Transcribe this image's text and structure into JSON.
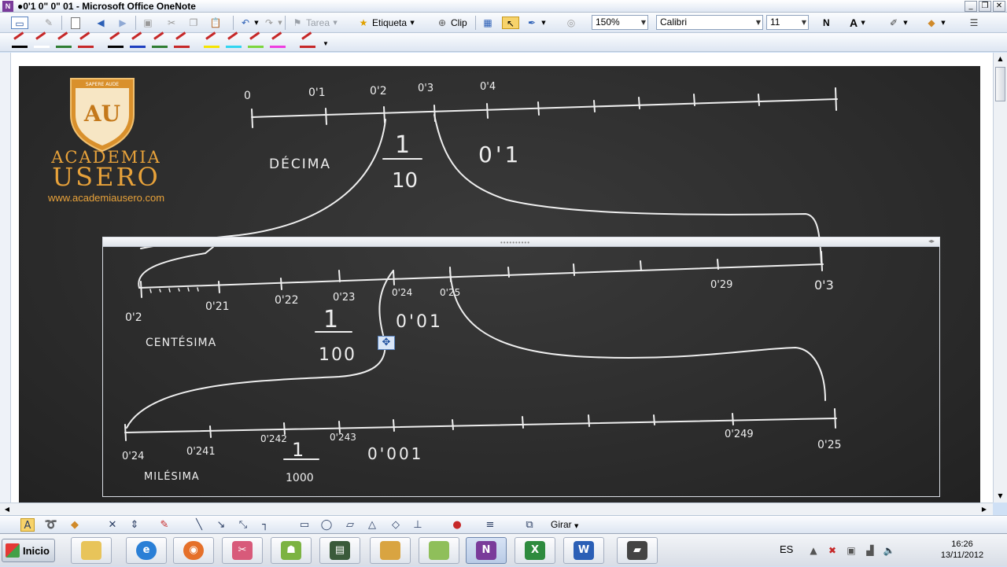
{
  "window": {
    "title": "●0'1 0\" 0\" 01 - Microsoft Office OneNote",
    "minimize": "_",
    "restore": "❐",
    "close": "✕"
  },
  "toolbar": {
    "tarea_label": "Tarea",
    "etiqueta_label": "Etiqueta",
    "clip_label": "Clip",
    "zoom_value": "150%",
    "font_name": "Calibri",
    "font_size": "11",
    "bold_label": "N",
    "font_color_label": "A"
  },
  "pens": [
    {
      "color": "#000000"
    },
    {
      "color": "#ffffff"
    },
    {
      "color": "#2e7d32"
    },
    {
      "color": "#c62828"
    },
    {
      "color": "#000000"
    },
    {
      "color": "#1e3fbf"
    },
    {
      "color": "#2e7d32"
    },
    {
      "color": "#c62828"
    },
    {
      "color": "#f5e400"
    },
    {
      "color": "#30d5f0"
    },
    {
      "color": "#7cd63c"
    },
    {
      "color": "#ee3ee0"
    },
    {
      "color": "#c62828"
    }
  ],
  "logo": {
    "motto": "SAPERE AUDE",
    "initials": "AU",
    "name_top": "ACADEMIA",
    "name_bottom": "USERO",
    "url": "www.academiausero.com"
  },
  "board": {
    "line1_labels": [
      "0",
      "0'1",
      "0'2",
      "0'3",
      "0'4"
    ],
    "decima_word": "DÉCIMA",
    "fraction_1_10": {
      "num": "1",
      "den": "10"
    },
    "decimal_01": "0'1",
    "line2_labels": [
      "0'2",
      "0'21",
      "0'22",
      "0'23",
      "0'24",
      "0'25",
      "0'29",
      "0'3"
    ],
    "centesima_word": "CENTÉSIMA",
    "fraction_1_100": {
      "num": "1",
      "den": "100"
    },
    "decimal_001": "0'01",
    "line3_labels": [
      "0'24",
      "0'241",
      "0'242",
      "0'243",
      "0'249",
      "0'25"
    ],
    "milesima_word": "MILÉSIMA",
    "fraction_1_1000": {
      "num": "1",
      "den": "1000"
    },
    "decimal_0001": "0'001"
  },
  "drawbar": {
    "girar_label": "Girar"
  },
  "taskbar": {
    "start_label": "Inicio",
    "language": "ES",
    "time": "16:26",
    "date": "13/11/2012"
  }
}
